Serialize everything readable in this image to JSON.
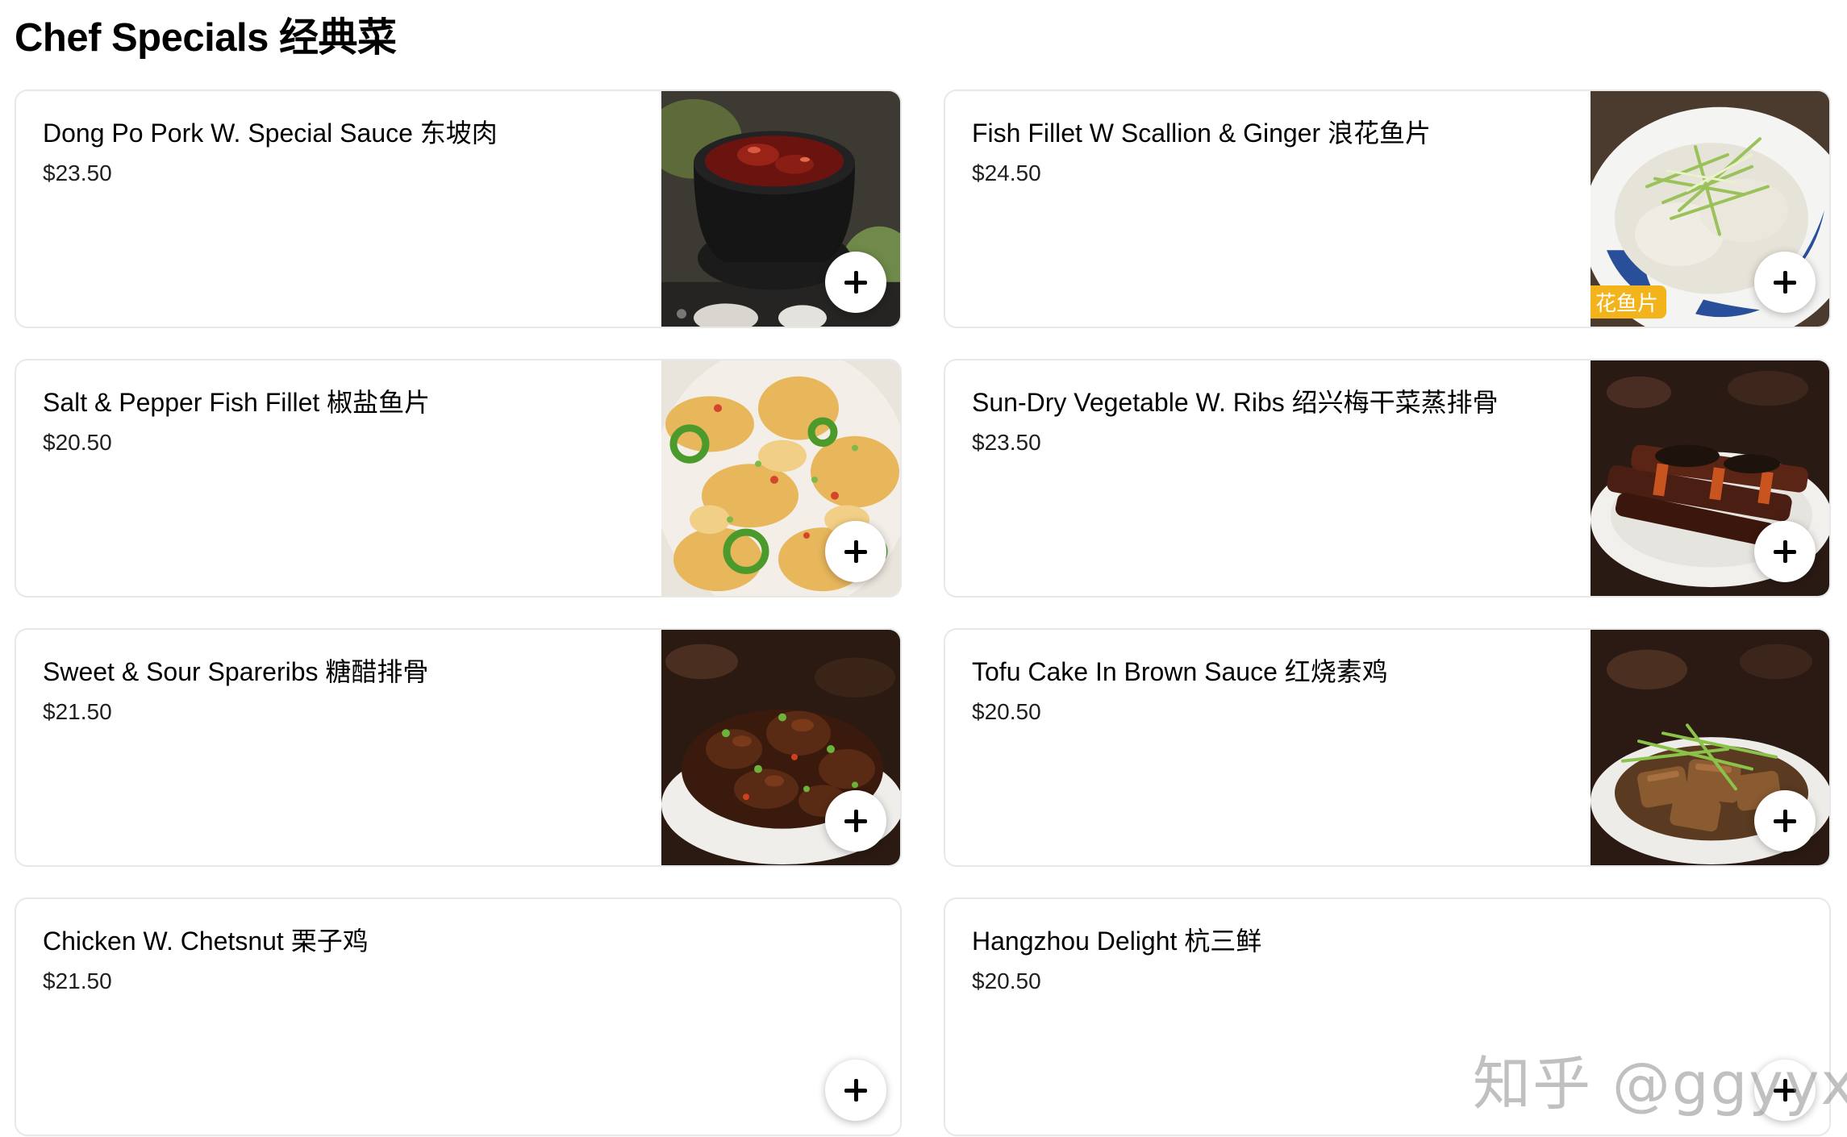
{
  "section": {
    "title": "Chef Specials 经典菜"
  },
  "items": [
    {
      "name": "Dong Po Pork W. Special Sauce 东坡肉",
      "price": "$23.50",
      "image": "braised-pork-pot"
    },
    {
      "name": "Fish Fillet W Scallion & Ginger 浪花鱼片",
      "price": "$24.50",
      "image": "fish-fillet-scallion",
      "image_tag": "花鱼片"
    },
    {
      "name": "Salt & Pepper Fish Fillet 椒盐鱼片",
      "price": "$20.50",
      "image": "salt-pepper-fish"
    },
    {
      "name": "Sun-Dry Vegetable W. Ribs 绍兴梅干菜蒸排骨",
      "price": "$23.50",
      "image": "ribs-dried-vegetable"
    },
    {
      "name": "Sweet & Sour Spareribs 糖醋排骨",
      "price": "$21.50",
      "image": "sweet-sour-ribs"
    },
    {
      "name": "Tofu Cake In Brown Sauce 红烧素鸡",
      "price": "$20.50",
      "image": "tofu-brown-sauce"
    },
    {
      "name": "Chicken W. Chetsnut 栗子鸡",
      "price": "$21.50",
      "image": null
    },
    {
      "name": "Hangzhou Delight 杭三鲜",
      "price": "$20.50",
      "image": null
    }
  ],
  "add_button_icon": "plus-icon",
  "watermark": "知乎 @ggyyxx",
  "colors": {
    "card_border": "#e8e8e8",
    "tag_background": "#f2b31b",
    "text": "#000000"
  }
}
